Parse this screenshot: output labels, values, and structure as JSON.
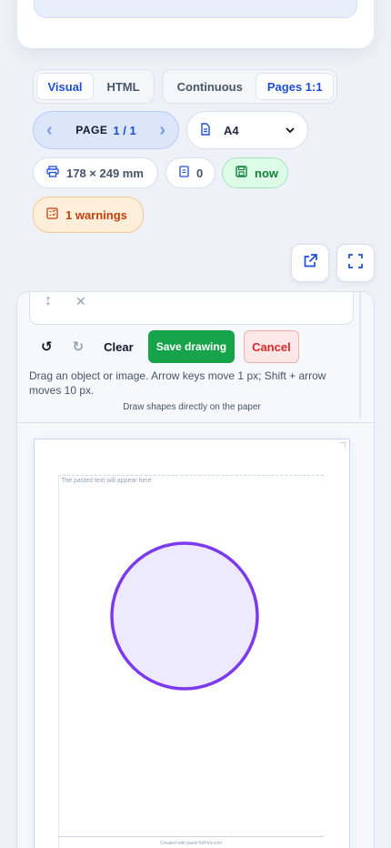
{
  "view_mode": {
    "options": [
      "Visual",
      "HTML"
    ],
    "selected": "Visual"
  },
  "layout_mode": {
    "options": [
      "Continuous",
      "Pages 1:1"
    ],
    "selected": "Pages 1:1"
  },
  "pager": {
    "prev_icon": "chevron-left-icon",
    "label": "PAGE",
    "value": "1 / 1",
    "next_icon": "chevron-right-icon"
  },
  "paper_size": {
    "icon": "document-icon",
    "value": "A4"
  },
  "stats": {
    "dimensions": "178 × 249 mm",
    "count": "0",
    "saved": "now",
    "warnings": "1 warnings"
  },
  "drawing": {
    "clear_label": "Clear",
    "save_label": "Save drawing",
    "cancel_label": "Cancel",
    "help_text": "Drag an object or image. Arrow keys move 1 px; Shift + arrow moves 10 px.",
    "hint": "Draw shapes directly on the paper"
  },
  "paper": {
    "placeholder": "The pasted text will appear here",
    "footer": "Created with pasteToPrint.com"
  },
  "colors": {
    "accent": "#1d4ed8",
    "save": "#16a34a",
    "cancel": "#dc2626",
    "warning": "#c2410c",
    "circle_stroke": "#7c3aed",
    "circle_fill": "#ede9fe"
  }
}
